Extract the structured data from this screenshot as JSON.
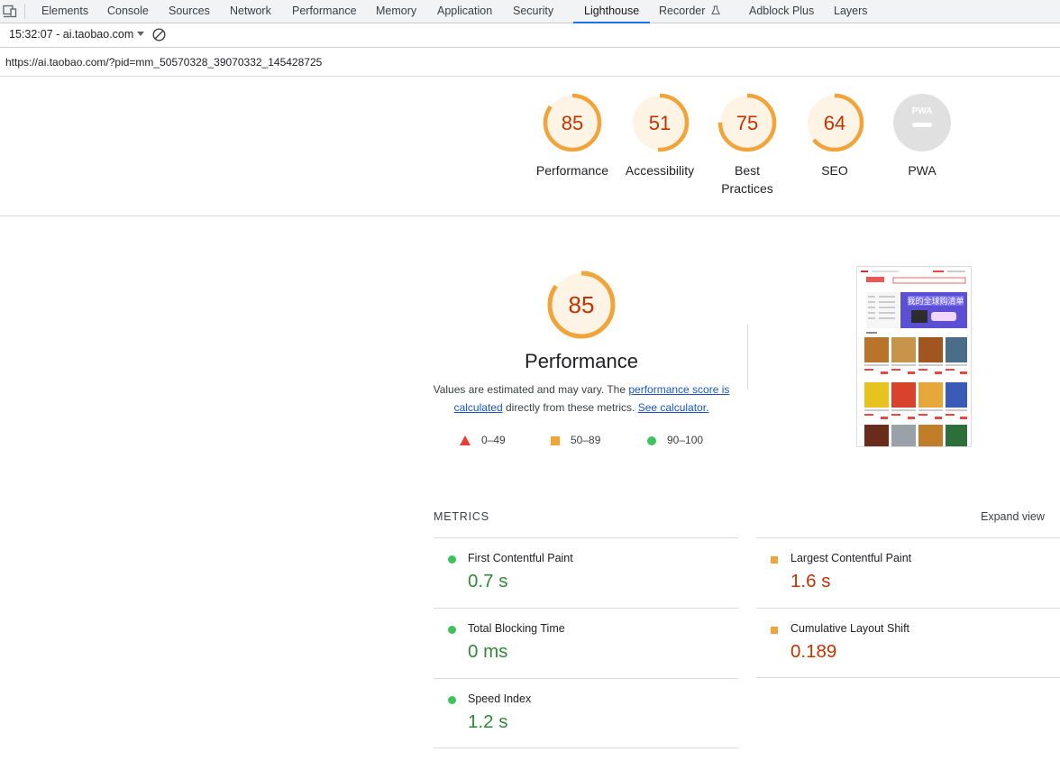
{
  "devtools": {
    "tabs": [
      {
        "label": "Elements"
      },
      {
        "label": "Console"
      },
      {
        "label": "Sources"
      },
      {
        "label": "Network"
      },
      {
        "label": "Performance"
      },
      {
        "label": "Memory"
      },
      {
        "label": "Application"
      },
      {
        "label": "Security"
      },
      {
        "label": "Lighthouse",
        "active": true
      },
      {
        "label": "Recorder"
      },
      {
        "label": "Adblock Plus"
      },
      {
        "label": "Layers"
      }
    ]
  },
  "toolbar": {
    "report_selector": "15:32:07 - ai.taobao.com"
  },
  "report": {
    "url": "https://ai.taobao.com/?pid=mm_50570328_39070332_145428725"
  },
  "gauges": [
    {
      "score": "85",
      "label": "Performance",
      "fraction": 0.85
    },
    {
      "score": "51",
      "label": "Accessibility",
      "fraction": 0.51
    },
    {
      "score": "75",
      "label": "Best Practices",
      "fraction": 0.75
    },
    {
      "score": "64",
      "label": "SEO",
      "fraction": 0.64
    },
    {
      "score": "",
      "label": "PWA",
      "fraction": 0,
      "badge": "PWA"
    }
  ],
  "performance": {
    "score": "85",
    "fraction": 0.85,
    "title": "Performance",
    "desc_prefix": "Values are estimated and may vary. The ",
    "desc_link1": "performance score is calculated",
    "desc_mid": " directly from these metrics. ",
    "desc_link2": "See calculator.",
    "legend": [
      {
        "shape": "triangle",
        "range": "0–49",
        "color": "#eb3d32"
      },
      {
        "shape": "square",
        "range": "50–89",
        "color": "#f0a43a"
      },
      {
        "shape": "circle",
        "range": "90–100",
        "color": "#3cc45b"
      }
    ]
  },
  "metrics": {
    "header": "METRICS",
    "expand": "Expand view",
    "items": [
      {
        "name": "First Contentful Paint",
        "value": "0.7 s",
        "rating": "pass"
      },
      {
        "name": "Largest Contentful Paint",
        "value": "1.6 s",
        "rating": "average"
      },
      {
        "name": "Total Blocking Time",
        "value": "0 ms",
        "rating": "pass"
      },
      {
        "name": "Cumulative Layout Shift",
        "value": "0.189",
        "rating": "average"
      },
      {
        "name": "Speed Index",
        "value": "1.2 s",
        "rating": "pass"
      }
    ]
  },
  "thumbnail": {
    "banner_text": "我的全球购清单"
  },
  "colors": {
    "average_ring": "#f0a43a",
    "average_fill": "#fef4e6",
    "average_text": "#c33300",
    "pass": "#2e8a36",
    "accent": "#1a73e8"
  }
}
